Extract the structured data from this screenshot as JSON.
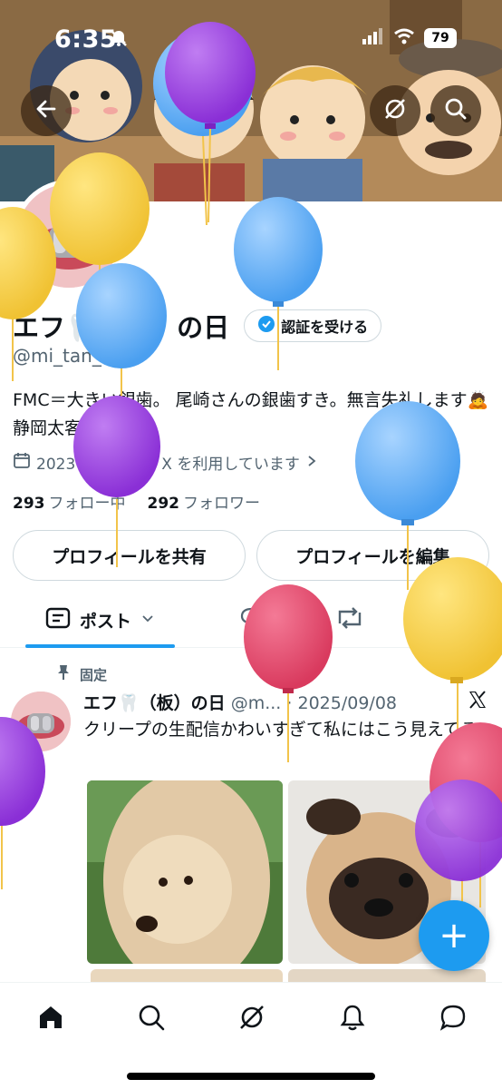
{
  "status_bar": {
    "time": "6:35",
    "battery": "79"
  },
  "profile": {
    "name": "エフ🦷（板）の日",
    "verify_label": "認証を受ける",
    "handle": "@mi_tan_chp",
    "bio": "FMC＝大きい銀歯。 尾崎さんの銀歯すき。無言失礼します🙇静岡太客DH🦷",
    "joined": "2023 年 9月から X を利用しています",
    "following_count": "293",
    "following_label": "フォロー中",
    "followers_count": "292",
    "followers_label": "フォロワー"
  },
  "buttons": {
    "share": "プロフィールを共有",
    "edit": "プロフィールを編集"
  },
  "tabs": {
    "posts": "ポスト"
  },
  "pinned_tweet": {
    "pinned_label": "固定",
    "author_name": "エフ🦷（板）の日",
    "author_handle": "@m...",
    "date": "· 2025/09/08",
    "text": "クリープの生配信かわいすぎて私にはこう見えてる"
  },
  "fab": {
    "label": "+"
  },
  "colors": {
    "accent": "#1d9bf0",
    "text": "#0f1419",
    "muted": "#536471",
    "border": "#cfd9de"
  },
  "icons": [
    "back-arrow-icon",
    "grok-icon",
    "search-icon",
    "verified-badge-icon",
    "calendar-icon",
    "chevron-right-icon",
    "post-list-icon",
    "chevron-down-icon",
    "reply-icon",
    "repost-icon",
    "media-icon",
    "pin-icon",
    "x-logo-icon",
    "home-icon",
    "explore-icon",
    "grok-nav-icon",
    "notifications-icon",
    "messages-icon"
  ]
}
